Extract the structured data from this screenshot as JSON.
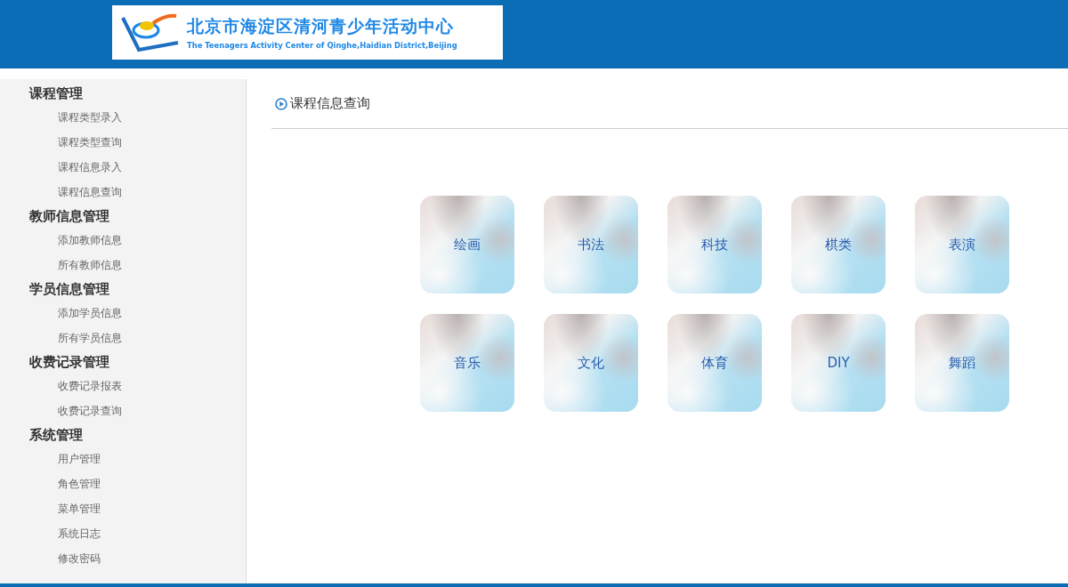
{
  "header": {
    "logo_title": "北京市海淀区清河青少年活动中心",
    "logo_subtitle": "The Teenagers Activity Center of Qinghe,Haidian District,Beijing"
  },
  "sidebar": {
    "groups": [
      {
        "title": "课程管理",
        "items": [
          "课程类型录入",
          "课程类型查询",
          "课程信息录入",
          "课程信息查询"
        ]
      },
      {
        "title": "教师信息管理",
        "items": [
          "添加教师信息",
          "所有教师信息"
        ]
      },
      {
        "title": "学员信息管理",
        "items": [
          "添加学员信息",
          "所有学员信息"
        ]
      },
      {
        "title": "收费记录管理",
        "items": [
          "收费记录报表",
          "收费记录查询"
        ]
      },
      {
        "title": "系统管理",
        "items": [
          "用户管理",
          "角色管理",
          "菜单管理",
          "系统日志",
          "修改密码"
        ]
      }
    ]
  },
  "content": {
    "title": "课程信息查询",
    "categories": [
      "绘画",
      "书法",
      "科技",
      "棋类",
      "表演",
      "音乐",
      "文化",
      "体育",
      "DIY",
      "舞蹈"
    ]
  }
}
